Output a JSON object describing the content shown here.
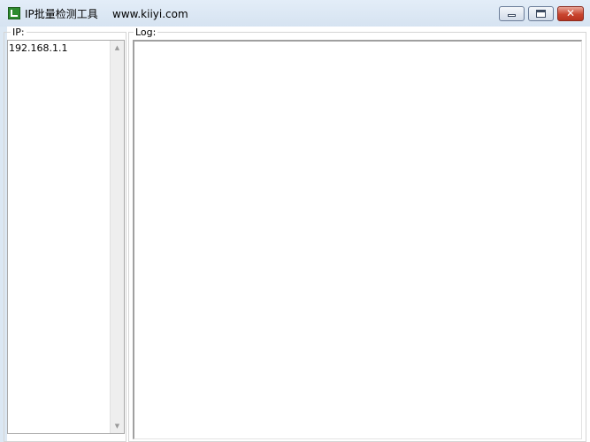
{
  "window": {
    "title": "IP批量检测工具",
    "url_text": "www.kiiyi.com",
    "close_glyph": "✕",
    "icons": {
      "app": "app-logo-icon",
      "minimize": "minimize-icon",
      "maximize": "maximize-icon",
      "close": "close-icon"
    }
  },
  "ip_panel": {
    "label": "IP:",
    "items": [
      "192.168.1.1"
    ],
    "scroll_up_glyph": "▲",
    "scroll_down_glyph": "▼"
  },
  "log_panel": {
    "label": "Log:",
    "content": ""
  },
  "colors": {
    "titlebar": "#dbe7f3",
    "close_button": "#c9452f",
    "app_icon": "#2e8b2e"
  }
}
